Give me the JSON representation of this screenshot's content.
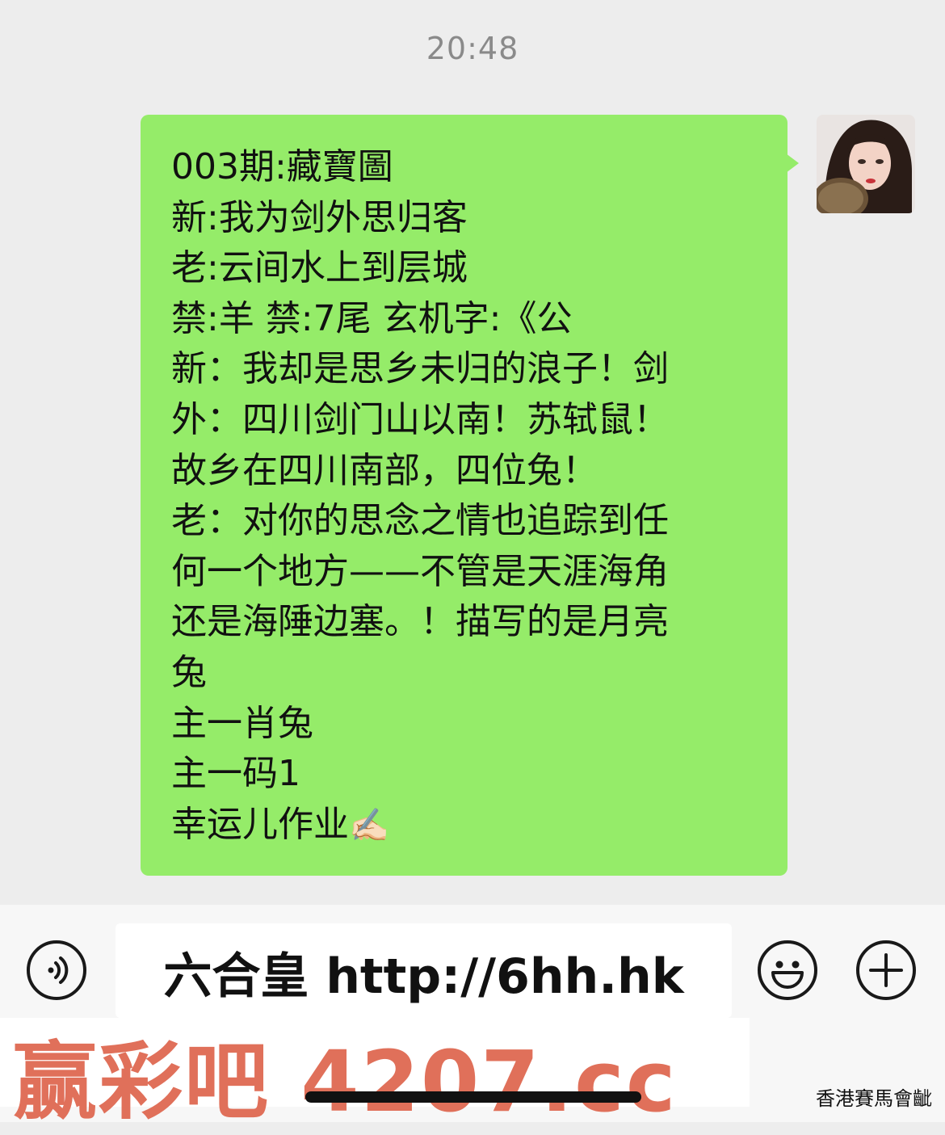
{
  "timestamp": "20:48",
  "message": {
    "lines": [
      "003期:藏寶圖",
      "新:我为剑外思归客",
      "老:云间水上到层城",
      "禁:羊 禁:7尾 玄机字:《公",
      "新：我却是思乡未归的浪子！剑",
      "外：四川剑门山以南！苏轼鼠！",
      "故乡在四川南部，四位兔！",
      "老：对你的思念之情也追踪到任",
      "何一个地方——不管是天涯海角",
      "还是海陲边塞。！描写的是月亮",
      "兔",
      "主一肖兔",
      "主一码1",
      "幸运儿作业"
    ],
    "trailing_emoji": "✍🏻"
  },
  "input_bar": {
    "text_value": "六合皇 http://6hh.hk",
    "voice_icon": "voice-icon",
    "emoji_icon": "emoji-icon",
    "plus_icon": "plus-icon"
  },
  "watermark": {
    "red_text": "赢彩吧 4207.cc",
    "corner_text": "香港賽馬會齜"
  },
  "colors": {
    "bubble": "#95ec69",
    "background": "#ededed",
    "watermark_red": "#e0705a"
  }
}
